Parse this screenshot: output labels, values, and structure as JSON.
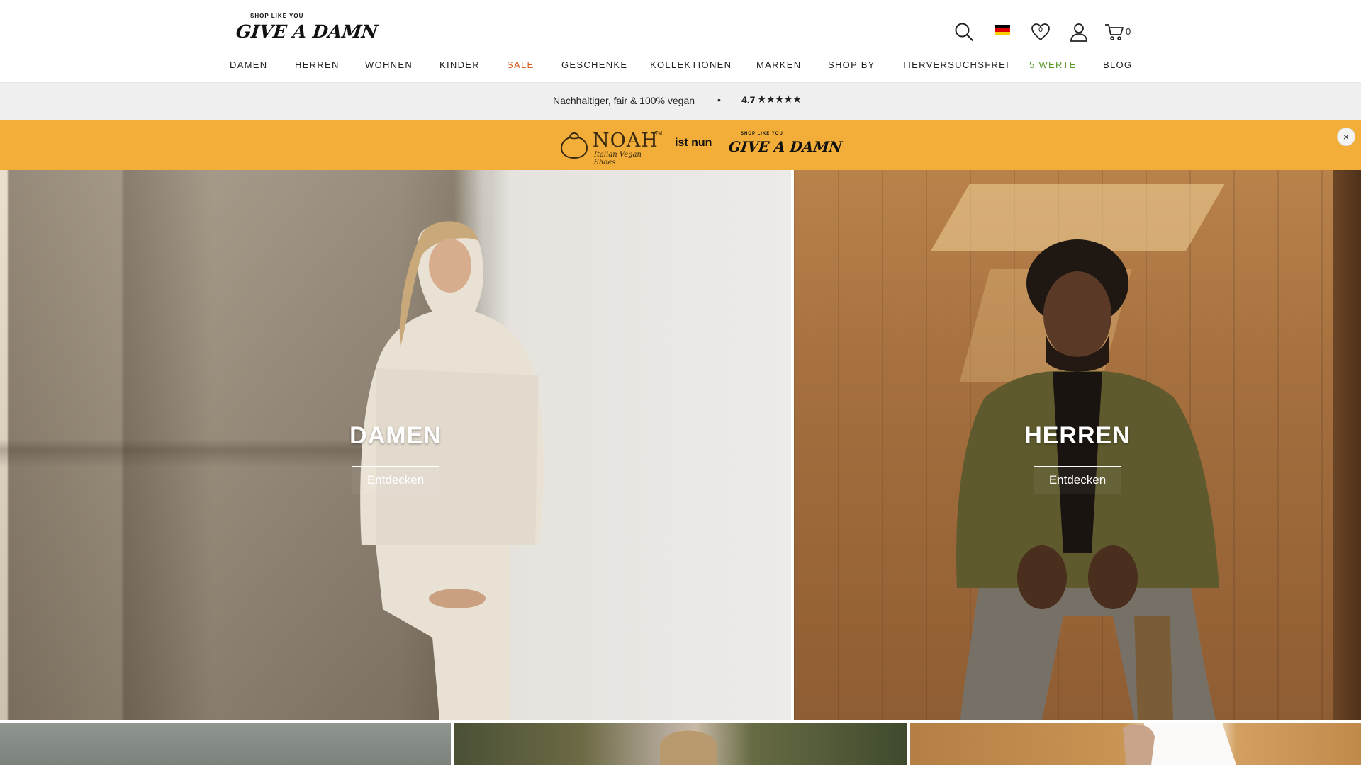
{
  "header": {
    "logo": {
      "tagline": "SHOP LIKE YOU",
      "wordmark": "GIVE A DAMN"
    },
    "icons": {
      "search": "search-icon",
      "language_flag": "germany-flag-icon",
      "wishlist": "heart-icon",
      "wishlist_count": "0",
      "account": "user-icon",
      "cart": "cart-icon",
      "cart_count": "0"
    },
    "flag_colors": [
      "#000000",
      "#dd0000",
      "#ffce00"
    ]
  },
  "nav": {
    "items": [
      {
        "label": "DAMEN"
      },
      {
        "label": "HERREN"
      },
      {
        "label": "WOHNEN"
      },
      {
        "label": "KINDER"
      },
      {
        "label": "SALE",
        "color": "#d35e22"
      },
      {
        "label": "GESCHENKE"
      },
      {
        "label": "KOLLEKTIONEN"
      },
      {
        "label": "MARKEN"
      },
      {
        "label": "SHOP BY"
      },
      {
        "label": "TIERVERSUCHSFREI"
      },
      {
        "label": "5 WERTE",
        "color": "#5a9a2a"
      },
      {
        "label": "BLOG"
      }
    ]
  },
  "infobar": {
    "claim": "Nachhaltiger, fair & 100% vegan",
    "separator": "•",
    "rating": "4.7",
    "stars": "★★★★★",
    "rating_stars_value": 4.7
  },
  "promo": {
    "background": "#f2ae38",
    "brand_name": "NOAH",
    "brand_tm": "TM",
    "brand_sub": "Italian Vegan Shoes",
    "text": "ist nun",
    "logo_tagline": "SHOP LIKE YOU",
    "logo_wordmark": "GIVE A DAMN",
    "close_label": "×"
  },
  "hero": {
    "left": {
      "title": "DAMEN",
      "button": "Entdecken"
    },
    "right": {
      "title": "HERREN",
      "button": "Entdecken"
    }
  }
}
